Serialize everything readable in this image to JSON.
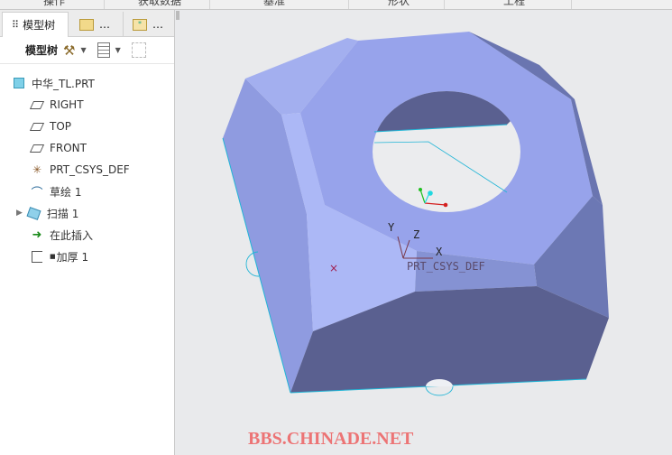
{
  "ribbon": {
    "tabs": [
      "操作",
      "获取数据",
      "基准",
      "形状",
      "工程"
    ]
  },
  "sidebar": {
    "tabs": [
      {
        "label": "模型树",
        "icon": "model-tree-icon"
      },
      {
        "label": "…",
        "icon": "folder-browser-icon"
      },
      {
        "label": "…",
        "icon": "favorites-folder-icon"
      }
    ],
    "toolbar_label": "模型树",
    "tree": [
      {
        "label": "中华_TL.PRT",
        "icon": "part-icon"
      },
      {
        "label": "RIGHT",
        "icon": "datum-plane-icon"
      },
      {
        "label": "TOP",
        "icon": "datum-plane-icon"
      },
      {
        "label": "FRONT",
        "icon": "datum-plane-icon"
      },
      {
        "label": "PRT_CSYS_DEF",
        "icon": "csys-icon"
      },
      {
        "label": "草绘 1",
        "icon": "sketch-icon"
      },
      {
        "label": "扫描 1",
        "icon": "sweep-icon"
      },
      {
        "label": "在此插入",
        "icon": "insert-here-arrow-icon"
      },
      {
        "label": "加厚 1",
        "icon": "thicken-icon"
      }
    ]
  },
  "viewport": {
    "csys_label": "PRT_CSYS_DEF",
    "axes": {
      "x": "X",
      "y": "Y",
      "z": "Z"
    },
    "model_color": "#97a3eb",
    "edge_color": "#21b5d6"
  },
  "watermark": "BBS.CHINADE.NET"
}
